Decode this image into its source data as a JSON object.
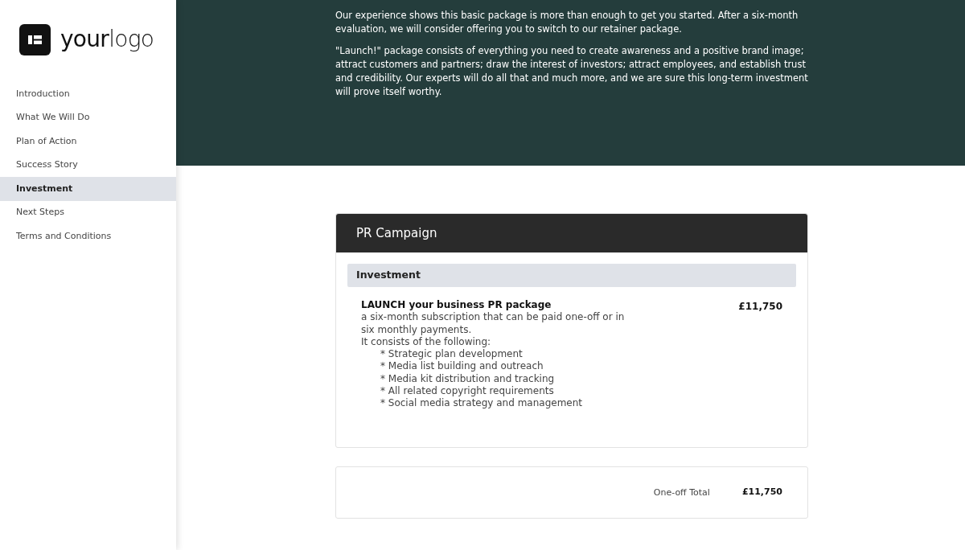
{
  "logo": {
    "text": "**your**logo"
  },
  "nav": [
    {
      "label": "Introduction",
      "selected": false
    },
    {
      "label": "What We Will Do",
      "selected": false
    },
    {
      "label": "Plan of Action",
      "selected": false
    },
    {
      "label": "Success Story",
      "selected": false
    },
    {
      "label": "Investment",
      "selected": true
    },
    {
      "label": "Next Steps",
      "selected": false
    },
    {
      "label": "Terms and Conditions",
      "selected": false
    }
  ],
  "intro": [
    "Our experience shows this basic package is more than enough to get you started. After a six-month evaluation, we will consider offering you to switch to our retainer package.",
    "\"Launch!\" package consists of everything you need to create awareness and a positive brand image; attract customers and partners; draw the interest of investors; attract employees, and establish trust and credibility. Our experts will do all that and much more, and we are sure this long-term investment will prove itself worthy."
  ],
  "pricing": {
    "title": "PR Campaign",
    "section": "Investment",
    "item": {
      "name": "LAUNCH your business PR package",
      "price": "£11,750",
      "description": [
        "a six-month subscription that can be paid one-off or in",
        "six monthly payments.",
        "It consists of the following:"
      ],
      "bullets": [
        "* Strategic plan development",
        "* Media list building and outreach",
        "* Media kit distribution and tracking",
        "* All related copyright requirements",
        "* Social media strategy and management"
      ]
    },
    "total_label": "One-off Total",
    "total": "£11,750"
  }
}
